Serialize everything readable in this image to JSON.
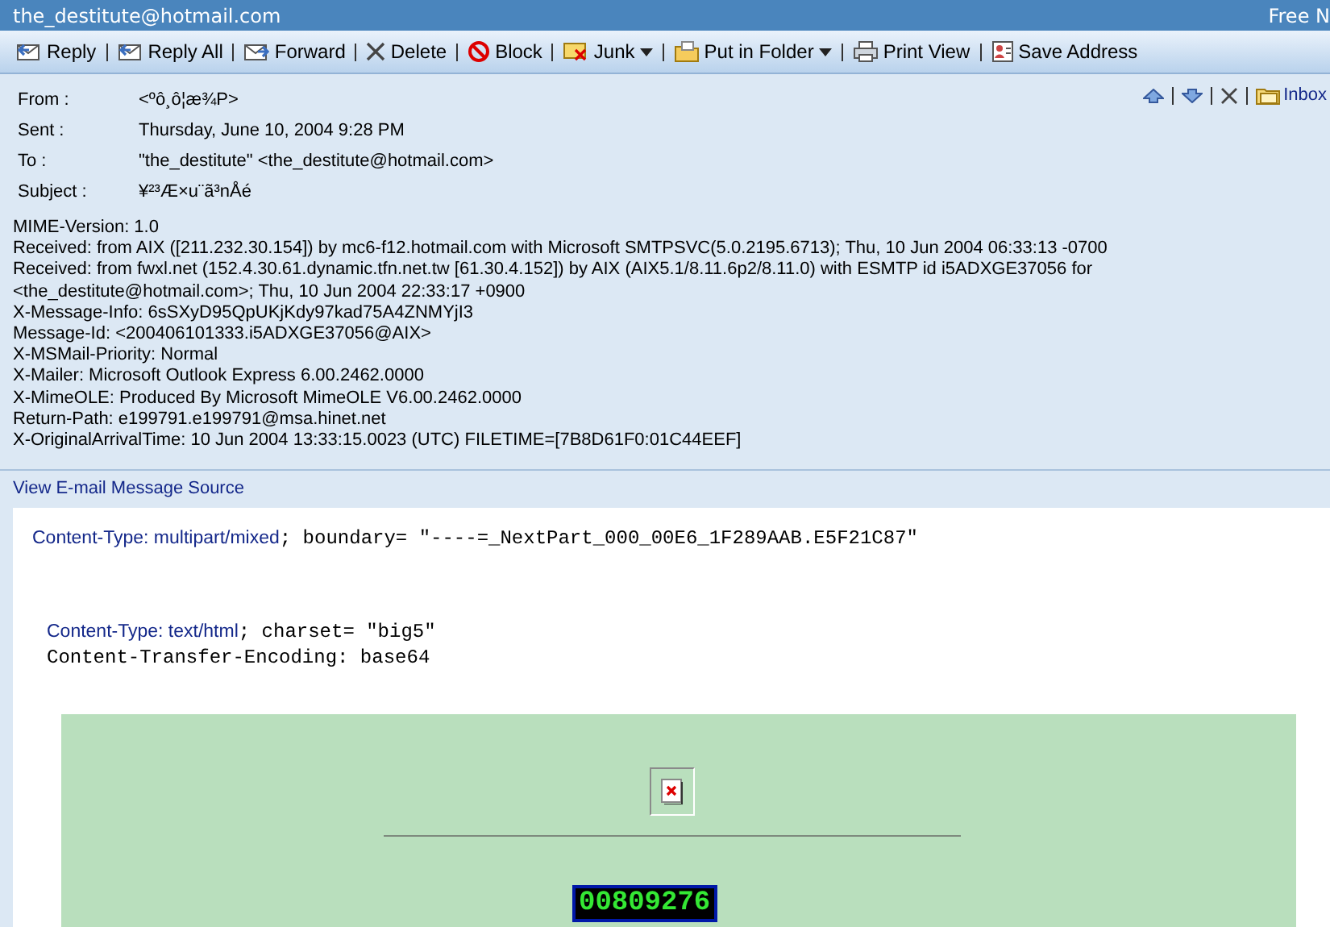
{
  "title_bar": {
    "account": "the_destitute@hotmail.com",
    "right_text": "Free N"
  },
  "toolbar": [
    {
      "label": "Reply",
      "kind": "reply",
      "dropdown": false
    },
    {
      "label": "Reply All",
      "kind": "replyall",
      "dropdown": false
    },
    {
      "label": "Forward",
      "kind": "forward",
      "dropdown": false
    },
    {
      "label": "Delete",
      "kind": "delete",
      "dropdown": false
    },
    {
      "label": "Block",
      "kind": "block",
      "dropdown": false
    },
    {
      "label": "Junk",
      "kind": "junk",
      "dropdown": true
    },
    {
      "label": "Put in Folder",
      "kind": "folder",
      "dropdown": true
    },
    {
      "label": "Print View",
      "kind": "print",
      "dropdown": false
    },
    {
      "label": "Save Address",
      "kind": "address",
      "dropdown": false
    }
  ],
  "header_fields": [
    {
      "label": "From :",
      "value": "<ºô¸ô¦æ¾P>"
    },
    {
      "label": "Sent :",
      "value": "Thursday, June 10, 2004 9:28 PM"
    },
    {
      "label": "To :",
      "value": "\"the_destitute\" <the_destitute@hotmail.com>"
    },
    {
      "label": "Subject :",
      "value": "¥²³Æ×u¨ã³nÅé"
    }
  ],
  "folder_link": "Inbox",
  "raw_headers": [
    "MIME-Version: 1.0",
    "Received: from AIX ([211.232.30.154]) by mc6-f12.hotmail.com with Microsoft SMTPSVC(5.0.2195.6713); Thu, 10 Jun 2004 06:33:13 -0700",
    "Received: from fwxl.net (152.4.30.61.dynamic.tfn.net.tw [61.30.4.152]) by AIX (AIX5.1/8.11.6p2/8.11.0) with ESMTP id i5ADXGE37056 for <the_destitute@hotmail.com>; Thu, 10 Jun 2004 22:33:17 +0900",
    "X-Message-Info: 6sSXyD95QpUKjKdy97kad75A4ZNMYjI3",
    "Message-Id: <200406101333.i5ADXGE37056@AIX>",
    "X-MSMail-Priority: Normal",
    "X-Mailer: Microsoft Outlook Express 6.00.2462.0000",
    "X-MimeOLE: Produced By Microsoft MimeOLE V6.00.2462.0000",
    "Return-Path: e199791.e199791@msa.hinet.net",
    "X-OriginalArrivalTime: 10 Jun 2004 13:33:15.0023 (UTC) FILETIME=[7B8D61F0:01C44EEF]"
  ],
  "source_link": "View E-mail Message Source",
  "body": {
    "multipart": {
      "type": "Content-Type: multipart/mixed",
      "rest": "; boundary= \"----=_NextPart_000_00E6_1F289AAB.E5F21C87\""
    },
    "part": {
      "type": "Content-Type: text/html",
      "rest": "; charset= \"big5\"",
      "encoding": "Content-Transfer-Encoding: base64"
    },
    "counter": "00809276"
  }
}
